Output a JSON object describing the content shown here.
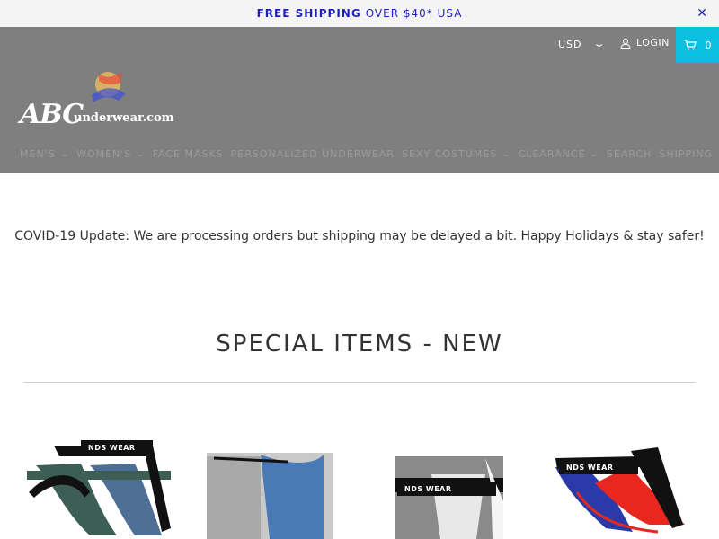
{
  "promo": {
    "strong": "FREE SHIPPING",
    "rest": "OVER $40* USA",
    "close_icon": "close-icon"
  },
  "utility": {
    "currency": "USD",
    "login": "LOGIN",
    "cart_count": "0",
    "cart_color": "#0bbfe0"
  },
  "logo": {
    "wordmark": "ABC",
    "domain": "underwear.com"
  },
  "nav": {
    "items": [
      {
        "label": "MEN'S",
        "has_dropdown": true
      },
      {
        "label": "WOMEN'S",
        "has_dropdown": true
      },
      {
        "label": "FACE MASKS",
        "has_dropdown": false
      },
      {
        "label": "PERSONALIZED UNDERWEAR",
        "has_dropdown": false
      },
      {
        "label": "SEXY COSTUMES",
        "has_dropdown": true
      },
      {
        "label": "CLEARANCE",
        "has_dropdown": true
      },
      {
        "label": "SEARCH",
        "has_dropdown": false
      },
      {
        "label": "SHIPPING",
        "has_dropdown": false
      }
    ]
  },
  "announcement": "COVID-19 Update: We are processing orders but shipping may be delayed a bit. Happy Holidays & stay safer!",
  "section": {
    "title": "SPECIAL ITEMS - NEW"
  },
  "products": [
    {
      "band_text": "NDS WEAR",
      "colors": [
        "#3d5e54",
        "#4d6f95"
      ]
    },
    {
      "band_text": "",
      "colors": [
        "#4a7ab5",
        "#c9c9c9"
      ]
    },
    {
      "band_text": "NDS WEAR",
      "colors": [
        "#e8e8e8",
        "#8a8a8a"
      ]
    },
    {
      "band_text": "NDS WEAR",
      "colors": [
        "#2a3aa8",
        "#e8271f"
      ]
    }
  ]
}
